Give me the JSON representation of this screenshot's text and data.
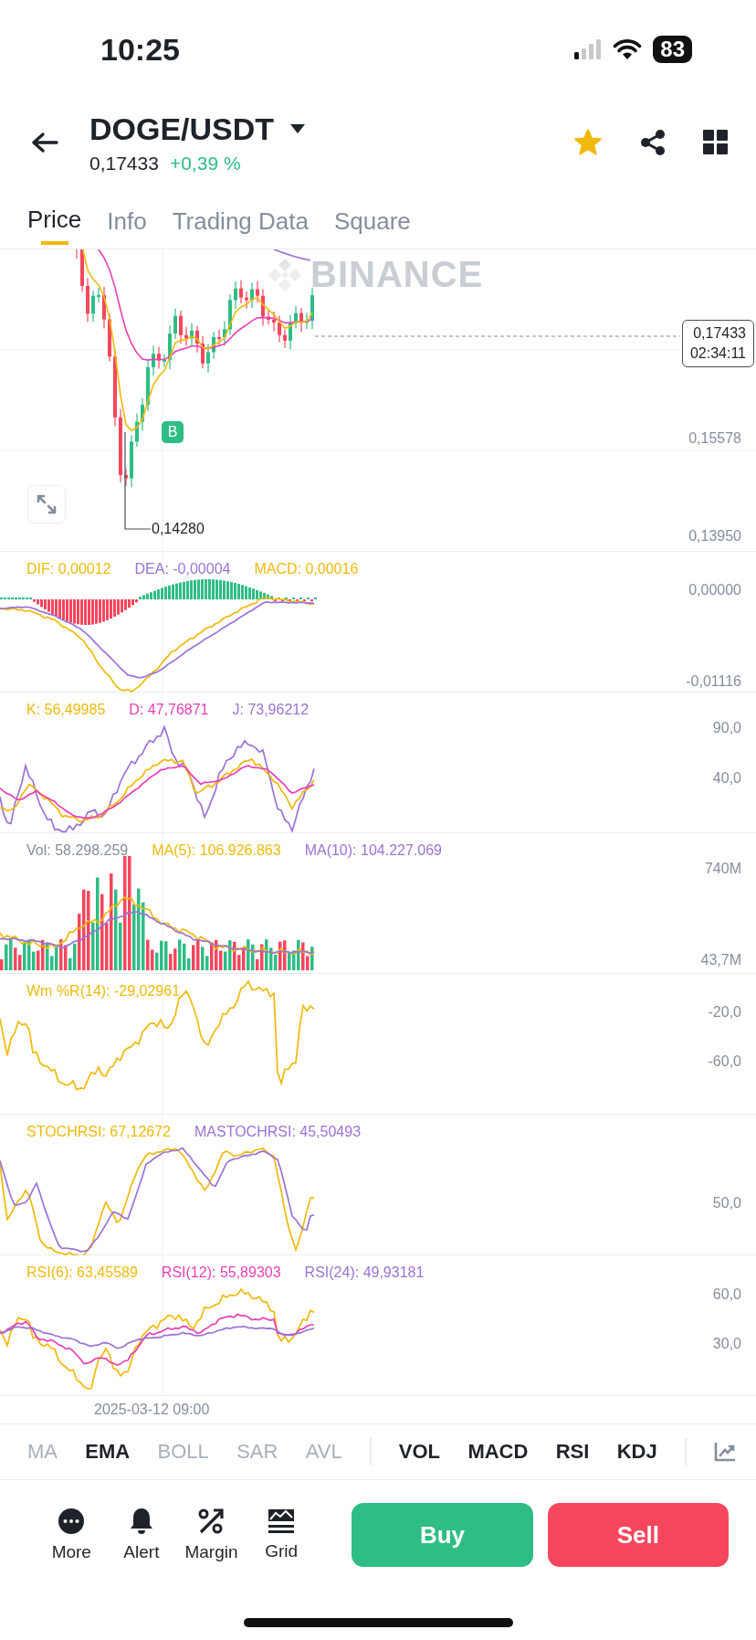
{
  "status_bar": {
    "time": "10:25",
    "battery": "83"
  },
  "header": {
    "pair": "DOGE/USDT",
    "price": "0,17433",
    "change": "+0,39 %",
    "favorite": true
  },
  "tabs": [
    {
      "label": "Price",
      "selected": true
    },
    {
      "label": "Info",
      "selected": false
    },
    {
      "label": "Trading Data",
      "selected": false
    },
    {
      "label": "Square",
      "selected": false
    }
  ],
  "chart": {
    "watermark": "BINANCE",
    "axis_labels": [
      "0,15578",
      "0,13950"
    ],
    "last_price": "0,17433",
    "countdown": "02:34:11",
    "low_label": "0,14280",
    "marker": "B"
  },
  "panels": [
    {
      "kind": "macd",
      "legend": [
        {
          "text": "DIF: 0,00012",
          "color": "#f0b90b"
        },
        {
          "text": "DEA: -0,00004",
          "color": "#9a73d6"
        },
        {
          "text": "MACD: 0,00016",
          "color": "#f0b90b"
        }
      ],
      "axis": [
        "0,00000",
        "-0,01116"
      ]
    },
    {
      "kind": "kdj",
      "legend": [
        {
          "text": "K: 56,49985",
          "color": "#f0b90b"
        },
        {
          "text": "D: 47,76871",
          "color": "#e83fb4"
        },
        {
          "text": "J: 73,96212",
          "color": "#9a73d6"
        }
      ],
      "axis": [
        "90,0",
        "40,0"
      ]
    },
    {
      "kind": "vol",
      "legend": [
        {
          "text": "Vol: 58.298.259",
          "color": "#848e9c"
        },
        {
          "text": "MA(5): 106.926.863",
          "color": "#f0b90b"
        },
        {
          "text": "MA(10): 104.227.069",
          "color": "#9a73d6"
        }
      ],
      "axis": [
        "740M",
        "43,7M"
      ]
    },
    {
      "kind": "wr",
      "legend": [
        {
          "text": "Wm %R(14): -29,02961",
          "color": "#f0b90b"
        }
      ],
      "axis": [
        "-20,0",
        "-60,0"
      ]
    },
    {
      "kind": "stochrsi",
      "legend": [
        {
          "text": "STOCHRSI: 67,12672",
          "color": "#f0b90b"
        },
        {
          "text": "MASTOCHRSI: 45,50493",
          "color": "#9a73d6"
        }
      ],
      "axis": [
        "50,0"
      ]
    },
    {
      "kind": "rsi",
      "legend": [
        {
          "text": "RSI(6): 63,45589",
          "color": "#f0b90b"
        },
        {
          "text": "RSI(12): 55,89303",
          "color": "#e83fb4"
        },
        {
          "text": "RSI(24): 49,93181",
          "color": "#9a73d6"
        }
      ],
      "axis": [
        "60,0",
        "30,0"
      ]
    }
  ],
  "date_label": "2025-03-12 09:00",
  "main_indicators": [
    {
      "label": "MA",
      "selected": false
    },
    {
      "label": "EMA",
      "selected": true
    },
    {
      "label": "BOLL",
      "selected": false
    },
    {
      "label": "SAR",
      "selected": false
    },
    {
      "label": "AVL",
      "selected": false
    }
  ],
  "sub_indicators": [
    {
      "label": "VOL",
      "selected": true
    },
    {
      "label": "MACD",
      "selected": true
    },
    {
      "label": "RSI",
      "selected": true
    },
    {
      "label": "KDJ",
      "selected": true
    }
  ],
  "actions": [
    {
      "label": "More",
      "kind": "more"
    },
    {
      "label": "Alert",
      "kind": "alert"
    },
    {
      "label": "Margin",
      "kind": "margin"
    },
    {
      "label": "Grid",
      "kind": "grid"
    }
  ],
  "trade_buttons": [
    {
      "label": "Buy",
      "kind": "buy"
    },
    {
      "label": "Sell",
      "kind": "sell"
    }
  ]
}
